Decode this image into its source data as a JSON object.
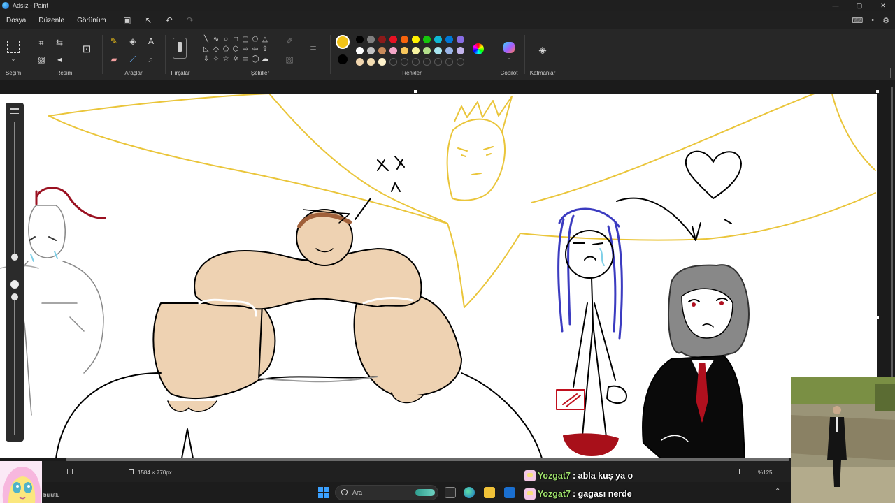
{
  "window": {
    "title": "Adsız - Paint",
    "controls": [
      "—",
      "▢",
      "✕"
    ]
  },
  "menu": {
    "items": [
      "Dosya",
      "Düzenle",
      "Görünüm"
    ]
  },
  "ribbon": {
    "groups": {
      "selection": "Seçim",
      "image": "Resim",
      "tools": "Araçlar",
      "brushes": "Fırçalar",
      "shapes": "Şekiller",
      "colors": "Renkler",
      "copilot": "Copilot",
      "layers": "Katmanlar"
    },
    "current_color_1": "#f2c318",
    "current_color_2": "#000000",
    "palette": [
      "#000000",
      "#7f7f7f",
      "#8b1a1a",
      "#e81123",
      "#f7630c",
      "#fff100",
      "#16c60c",
      "#0fb7d4",
      "#0078d7",
      "#886ce4",
      "#ffffff",
      "#c3c3c3",
      "#c88a5a",
      "#f4a7c8",
      "#f9c75c",
      "#f7f3a0",
      "#b4e08c",
      "#a8e6f0",
      "#9ab5e8",
      "#c3b4ec",
      "#f2d7b0",
      "#f5deb3",
      "#fff2cc",
      "empty",
      "empty",
      "empty",
      "empty",
      "empty",
      "empty",
      "empty"
    ]
  },
  "canvas": {
    "size_label": "1584 × 770px",
    "zoom": "%125"
  },
  "taskbar": {
    "weather": "bulutlu",
    "search_placeholder": "Ara"
  },
  "chat": [
    {
      "user": "Yozgat7",
      "message": ": abla kuş ya o"
    },
    {
      "user": "Yozgat7",
      "message": ": gagası nerde"
    }
  ]
}
